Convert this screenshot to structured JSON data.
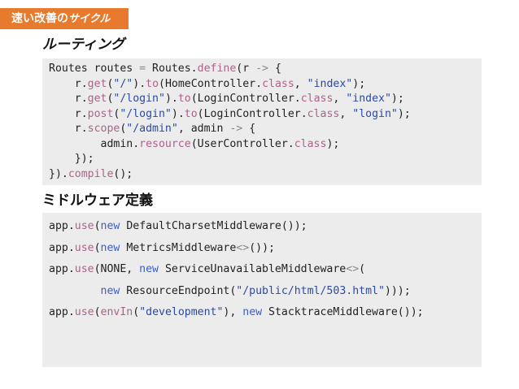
{
  "badge": {
    "text_main": "速い改善の",
    "text_emph": "サイクル",
    "color": "#e77a2c"
  },
  "routing": {
    "heading": "ルーティング",
    "code_lines": [
      "Routes routes = Routes.define(r -> {",
      "    r.get(\"/\").to(HomeController.class, \"index\");",
      "    r.get(\"/login\").to(LoginController.class, \"index\");",
      "    r.post(\"/login\").to(LoginController.class, \"login\");",
      "    r.scope(\"/admin\", admin -> {",
      "        admin.resource(UserController.class);",
      "    });",
      "}).compile();"
    ]
  },
  "middleware": {
    "heading": "ミドルウェア定義",
    "code_lines": [
      "app.use(new DefaultCharsetMiddleware());",
      "app.use(new MetricsMiddleware<>());",
      "app.use(NONE, new ServiceUnavailableMiddleware<>(",
      "        new ResourceEndpoint(\"/public/html/503.html\")));",
      "app.use(envIn(\"development\"), new StacktraceMiddleware());"
    ]
  },
  "colors": {
    "code_background": "#ececec",
    "string": "#2a4aa8",
    "keyword": "#3a5ec9",
    "method": "#b0608a"
  }
}
